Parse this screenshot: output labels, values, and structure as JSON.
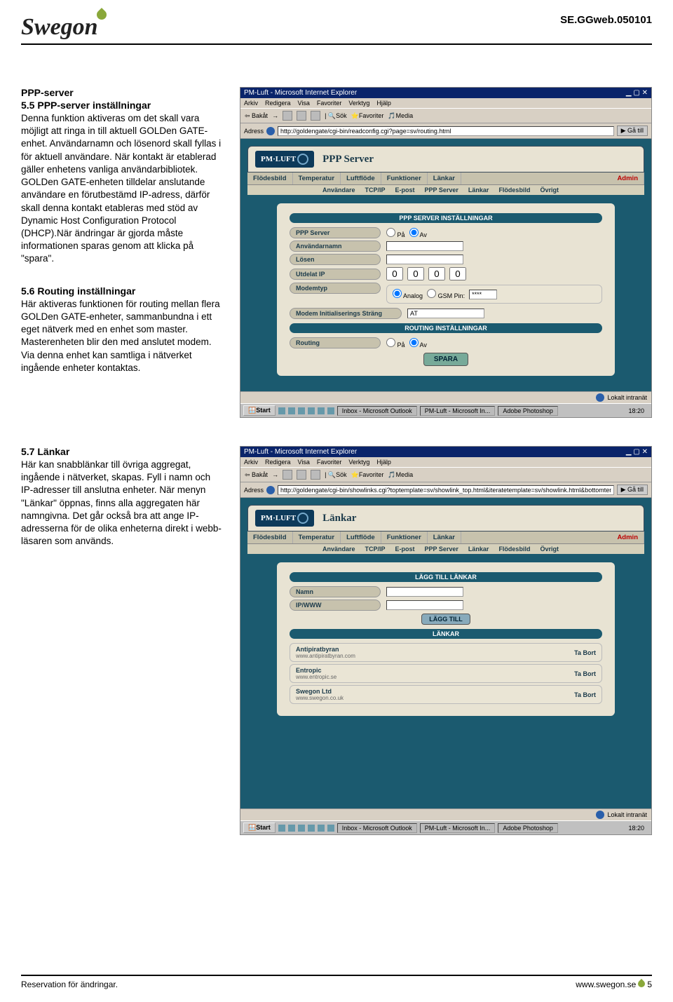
{
  "header": {
    "logo_text": "Swegon",
    "doc_id": "SE.GGweb.050101"
  },
  "sections": {
    "s55_hdr": "PPP-server",
    "s55_title": "5.5 PPP-server  inställningar",
    "s55_body": "Denna funktion aktiveras om det skall vara möjligt att ringa in till aktuell GOLDen GATE-enhet. Användarnamn och lösenord skall fyllas i för aktuell användare. När kontakt är etablerad gäller enhetens vanliga användarbibliotek. GOLDen GATE-enheten tilldelar anslutande användare en förutbestämd IP-adress, därför skall denna kontakt etableras med stöd av Dynamic Host Configuration Protocol (DHCP).När ändringar är gjorda måste informationen sparas genom att klicka på \"spara\".",
    "s56_title": "5.6 Routing inställningar",
    "s56_body": "Här aktiveras funktionen för routing mellan flera GOLDen GATE-enheter, sammanbundna i ett eget nätverk med en enhet som master. Masterenheten blir den med anslutet modem. Via denna enhet kan samtliga i nätverket ingående enheter kontaktas.",
    "s57_title": "5.7 Länkar",
    "s57_body": "Här kan snabblänkar till övriga aggregat, ingående i nätverket, skapas. Fyll i namn och IP-adresser till anslutna enheter. När menyn \"Länkar\" öppnas, finns alla aggregaten här namngivna. Det går också bra att ange IP-adresserna för de olika enheterna direkt i webb-läsaren som används."
  },
  "browser_common": {
    "window_title": "PM-Luft - Microsoft Internet Explorer",
    "menus": [
      "Arkiv",
      "Redigera",
      "Visa",
      "Favoriter",
      "Verktyg",
      "Hjälp"
    ],
    "toolbar_back": "Bakåt",
    "toolbar_sok": "Sök",
    "toolbar_fav": "Favoriter",
    "toolbar_media": "Media",
    "addr_label": "Adress",
    "go_label": "Gå till",
    "status_text": "Lokalt intranät",
    "taskbar_start": "Start",
    "taskbar_items": [
      "Inbox - Microsoft Outlook",
      "PM-Luft - Microsoft In...",
      "Adobe Photoshop"
    ],
    "taskbar_time": "18:20",
    "pm_logo": "PM·LUFT",
    "tabs": [
      "Flödesbild",
      "Temperatur",
      "Luftflöde",
      "Funktioner",
      "Länkar"
    ],
    "admin_tab": "Admin",
    "subtabs": [
      "Användare",
      "TCP/IP",
      "E-post",
      "PPP Server",
      "Länkar",
      "Flödesbild",
      "Övrigt"
    ]
  },
  "shot1": {
    "url": "http://goldengate/cgi-bin/readconfig.cgi?page=sv/routing.html",
    "page_title": "PPP Server",
    "hdr1": "PPP SERVER INSTÄLLNINGAR",
    "row_ppp": "PPP Server",
    "row_user": "Användarnamn",
    "row_pass": "Lösen",
    "row_ip": "Utdelat IP",
    "row_modem": "Modemtyp",
    "modem_analog": "Analog",
    "modem_gsm": "GSM Pin:",
    "gsm_pin": "****",
    "row_init": "Modem Initialiserings Sträng",
    "init_val": "AT",
    "hdr2": "ROUTING INSTÄLLNINGAR",
    "row_routing": "Routing",
    "radio_pa": "På",
    "radio_av": "Av",
    "btn_save": "SPARA"
  },
  "shot2": {
    "url": "http://goldengate/cgi-bin/showlinks.cgi?toptemplate=sv/showlink_top.html&iteratetemplate=sv/showlink.html&bottomtemplate=sv/showlink_bottom.html",
    "page_title": "Länkar",
    "hdr_add": "LÄGG TILL LÄNKAR",
    "row_name": "Namn",
    "row_ipwww": "IP/WWW",
    "btn_add": "LÄGG TILL",
    "hdr_links": "LÄNKAR",
    "links": [
      {
        "name": "Antipiratbyran",
        "sub": "www.antipiratbyran.com",
        "del": "Ta Bort"
      },
      {
        "name": "Entropic",
        "sub": "www.entropic.se",
        "del": "Ta Bort"
      },
      {
        "name": "Swegon Ltd",
        "sub": "www.swegon.co.uk",
        "del": "Ta Bort"
      }
    ]
  },
  "footer": {
    "left": "Reservation för ändringar.",
    "site": "www.swegon.se",
    "page": "5"
  }
}
